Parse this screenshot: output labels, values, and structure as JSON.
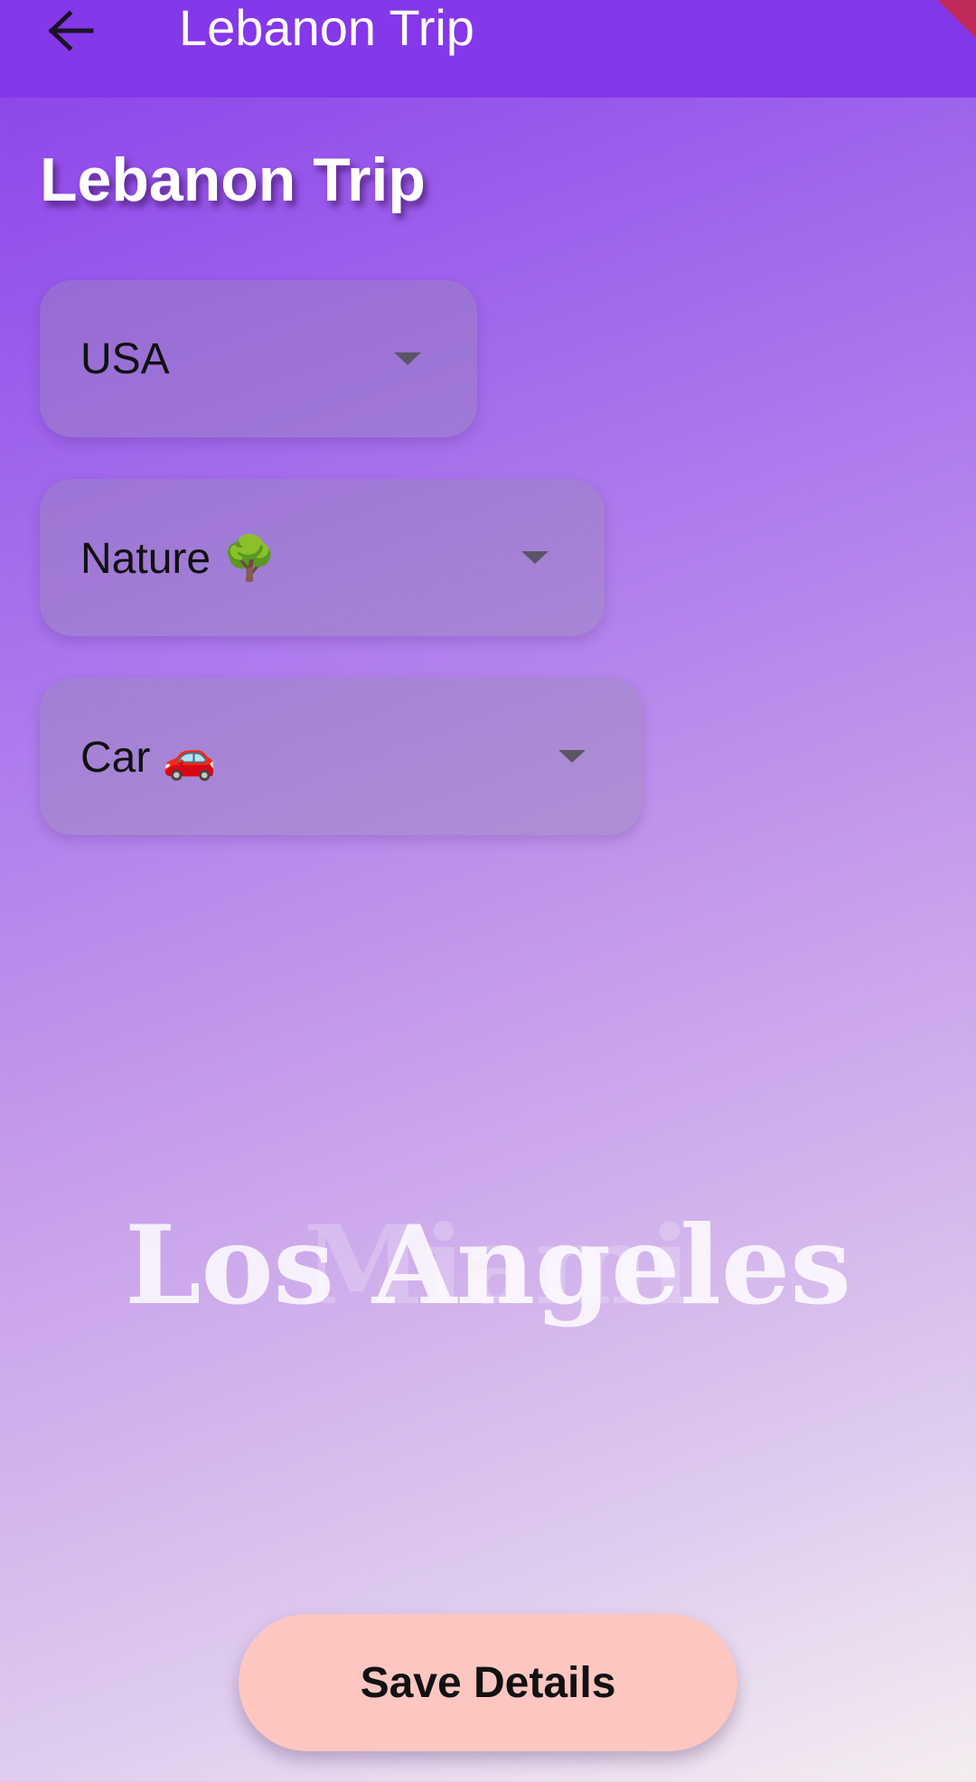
{
  "app_bar": {
    "title": "Lebanon Trip",
    "back_icon": "arrow-left-icon",
    "background_color": "#8537ea"
  },
  "page": {
    "heading": "Lebanon Trip"
  },
  "dropdowns": {
    "country": {
      "selected": "USA",
      "icon": "chevron-down-icon"
    },
    "trip_type": {
      "selected": "Nature 🌳",
      "icon": "chevron-down-icon"
    },
    "transport": {
      "selected": "Car 🚗",
      "icon": "chevron-down-icon"
    }
  },
  "city_carousel": {
    "previous": "Miami",
    "current": "Los Angeles"
  },
  "actions": {
    "save_label": "Save Details",
    "save_color": "#fec6c0"
  }
}
